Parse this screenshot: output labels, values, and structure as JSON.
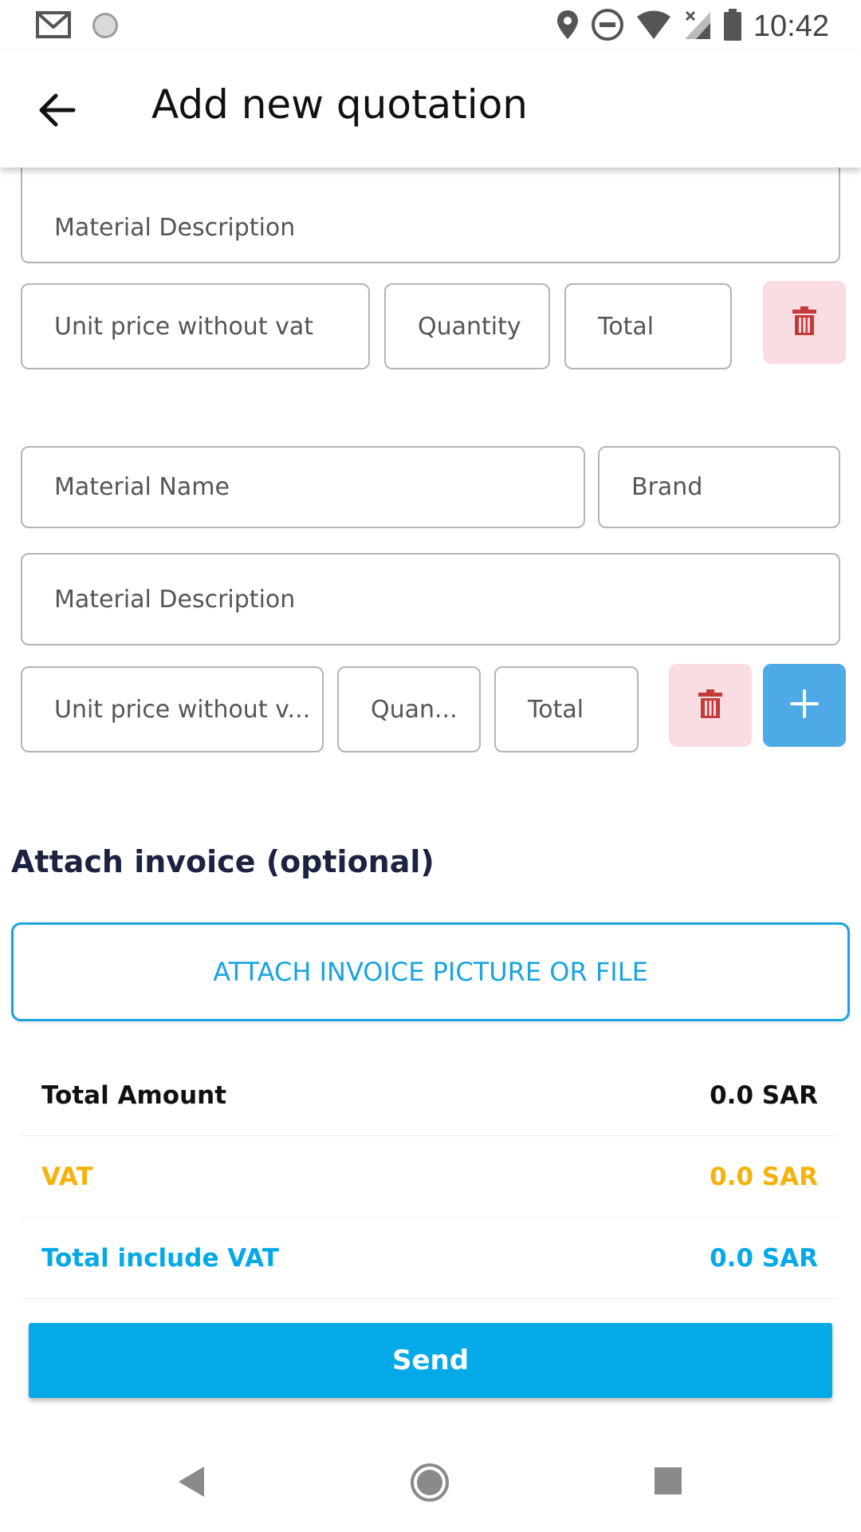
{
  "status_bar": {
    "time": "10:42",
    "left_icons": [
      "gmail-icon",
      "sync-icon"
    ],
    "right_icons": [
      "location-icon",
      "do-not-disturb-icon",
      "wifi-icon",
      "signal-icon",
      "battery-icon"
    ]
  },
  "app_bar": {
    "back_icon": "arrow-back-icon",
    "title": "Add new quotation"
  },
  "item1": {
    "description_placeholder": "Material Description",
    "unit_price_placeholder": "Unit price without vat",
    "quantity_placeholder": "Quantity",
    "total_placeholder": "Total",
    "delete_icon": "trash-icon"
  },
  "item2": {
    "name_placeholder": "Material Name",
    "brand_placeholder": "Brand",
    "description_placeholder": "Material Description",
    "unit_price_placeholder": "Unit price without v...",
    "quantity_placeholder": "Quan...",
    "total_placeholder": "Total",
    "delete_icon": "trash-icon",
    "add_icon": "plus-icon"
  },
  "attach": {
    "section_title": "Attach invoice (optional)",
    "button_label": "ATTACH INVOICE PICTURE OR FILE"
  },
  "summary": {
    "total_label": "Total Amount",
    "total_value": "0.0 SAR",
    "vat_label": "VAT",
    "vat_value": "0.0 SAR",
    "total_vat_label": "Total include VAT",
    "total_vat_value": "0.0 SAR"
  },
  "send_label": "Send",
  "colors": {
    "accent": "#04a9e7",
    "vat": "#f5b10c",
    "delete_bg": "#f9dde3",
    "delete_icon": "#c73a3a",
    "add_bg": "#4eaae6"
  },
  "nav_bar": {
    "icons": [
      "nav-back-icon",
      "nav-home-icon",
      "nav-recents-icon"
    ]
  }
}
